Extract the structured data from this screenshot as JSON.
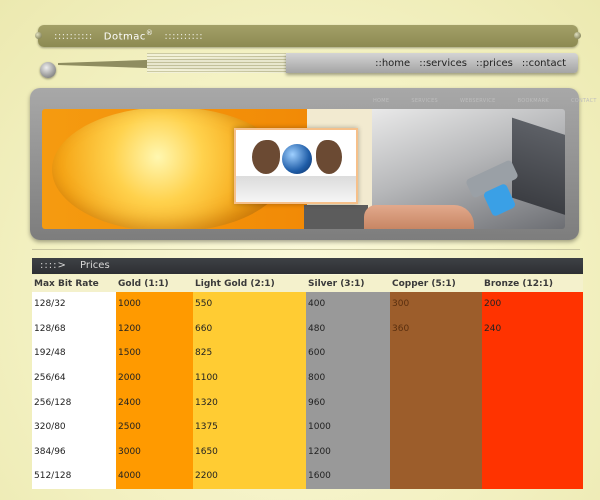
{
  "brand": {
    "dots_left": "::::::::::",
    "name": "Dotmac",
    "mark": "®",
    "dots_right": "::::::::::"
  },
  "nav": [
    {
      "label": "::home"
    },
    {
      "label": "::services"
    },
    {
      "label": "::prices"
    },
    {
      "label": "::contact"
    }
  ],
  "banner_nav": [
    "HOME",
    "SERVICES",
    "WEBSERVICE",
    "BOOKMARK",
    "CONTACT"
  ],
  "prices": {
    "header_arrow": "::::>",
    "title": "Prices",
    "columns": [
      "Max Bit Rate",
      "Gold (1:1)",
      "Light Gold (2:1)",
      "Silver (3:1)",
      "Copper (5:1)",
      "Bronze (12:1)"
    ],
    "rows": [
      [
        "128/32",
        "1000",
        "550",
        "400",
        "300",
        "200"
      ],
      [
        "128/68",
        "1200",
        "660",
        "480",
        "360",
        "240"
      ],
      [
        "192/48",
        "1500",
        "825",
        "600",
        "",
        ""
      ],
      [
        "256/64",
        "2000",
        "1100",
        "800",
        "",
        ""
      ],
      [
        "256/128",
        "2400",
        "1320",
        "960",
        "",
        ""
      ],
      [
        "320/80",
        "2500",
        "1375",
        "1000",
        "",
        ""
      ],
      [
        "384/96",
        "3000",
        "1650",
        "1200",
        "",
        ""
      ],
      [
        "512/128",
        "4000",
        "2200",
        "1600",
        "",
        ""
      ]
    ]
  },
  "colors": {
    "gold": "#ff9a00",
    "light_gold": "#ffcc33",
    "silver": "#999999",
    "copper": "#9c5d2b",
    "bronze": "#ff3300",
    "header_bar": "#2d2f33",
    "brand_bar": "#8c8a52"
  }
}
